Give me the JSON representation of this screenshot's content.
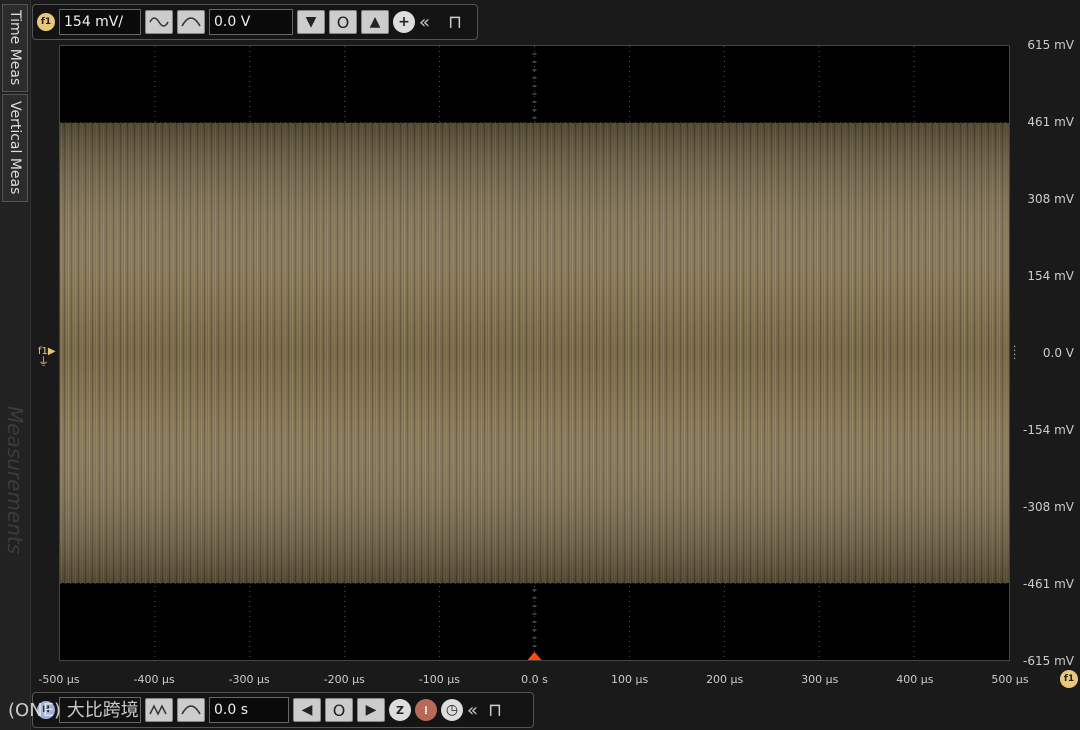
{
  "side": {
    "tab_time": "Time Meas",
    "tab_vertical": "Vertical Meas",
    "ghost": "Measurements"
  },
  "top_toolbar": {
    "badge": "f1",
    "scale_value": "154 mV/",
    "offset_value": "0.0 V"
  },
  "bottom_toolbar": {
    "badge": "H",
    "time_value": "0.0 s"
  },
  "y_axis_labels": [
    "615 mV",
    "461 mV",
    "308 mV",
    "154 mV",
    "0.0 V",
    "-154 mV",
    "-308 mV",
    "-461 mV",
    "-615 mV"
  ],
  "x_axis_labels": [
    "-500 µs",
    "-400 µs",
    "-300 µs",
    "-200 µs",
    "-100 µs",
    "0.0 s",
    "100 µs",
    "200 µs",
    "300 µs",
    "400 µs",
    "500 µs"
  ],
  "channel_marker": "f1",
  "axis_chip": "f1",
  "watermark": "(ONE) 大比跨境",
  "colors": {
    "trace": "#8c7a55",
    "background": "#000000",
    "trigger": "#ff4a10",
    "badge": "#e8c77a"
  },
  "chart_data": {
    "type": "area",
    "x_range_us": [
      -500,
      500
    ],
    "y_range_mV": [
      -615,
      615
    ],
    "signal_envelope_mV": [
      -461,
      461
    ],
    "grid": true
  }
}
